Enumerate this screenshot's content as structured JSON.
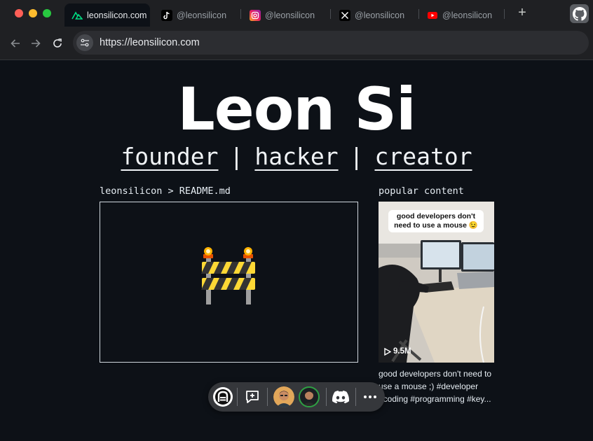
{
  "browser": {
    "tabs": [
      {
        "label": "leonsilicon.com",
        "icon": "nuxt-icon",
        "active": true
      },
      {
        "label": "@leonsilicon",
        "icon": "tiktok-icon"
      },
      {
        "label": "@leonsilicon",
        "icon": "instagram-icon"
      },
      {
        "label": "@leonsilicon",
        "icon": "x-icon"
      },
      {
        "label": "@leonsilicon",
        "icon": "youtube-icon"
      }
    ],
    "new_tab": "+",
    "url": "https://leonsilicon.com"
  },
  "page": {
    "title": "Leon Si",
    "roles": [
      "founder",
      "hacker",
      "creator"
    ],
    "separator": "|",
    "readme_label": "leonsilicon > README.md",
    "readme_icon": "construction-barrier-icon",
    "popular_label": "popular content",
    "video": {
      "overlay_text": "good developers don't need to use a mouse 😉",
      "views": "9.5M",
      "description": "good developers don't need to use a mouse ;) #developer #coding #programming #key..."
    }
  },
  "dock": {
    "items": [
      "app-logo-icon",
      "feedback-icon",
      "avatar-1",
      "avatar-2",
      "discord-icon",
      "more-icon"
    ]
  },
  "colors": {
    "background": "#0d1117",
    "chrome": "#1f2023",
    "text": "#ffffff"
  }
}
